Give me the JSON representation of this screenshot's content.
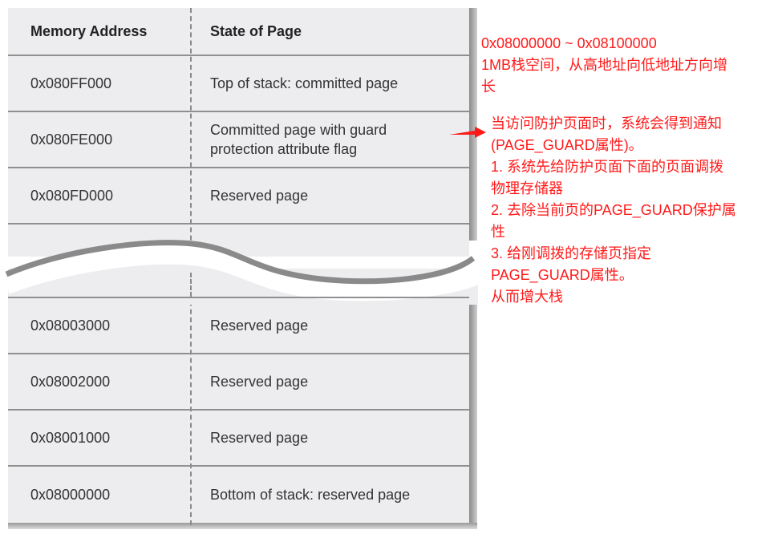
{
  "table": {
    "headers": [
      "Memory Address",
      "State of Page"
    ],
    "top_rows": [
      {
        "address": "0x080FF000",
        "state": "Top of stack: committed page"
      },
      {
        "address": "0x080FE000",
        "state": "Committed page with guard protection attribute flag"
      },
      {
        "address": "0x080FD000",
        "state": "Reserved page"
      }
    ],
    "bottom_rows": [
      {
        "address": "0x08003000",
        "state": "Reserved page"
      },
      {
        "address": "0x08002000",
        "state": "Reserved page"
      },
      {
        "address": "0x08001000",
        "state": "Reserved page"
      },
      {
        "address": "0x08000000",
        "state": "Bottom of stack: reserved page"
      }
    ]
  },
  "notes": {
    "range": [
      "0x08000000 ~ 0x08100000",
      "1MB栈空间，从高地址向低地址方向增",
      "长"
    ],
    "guard": [
      "当访问防护页面时，系统会得到通知",
      "(PAGE_GUARD属性)。",
      "1. 系统先给防护页面下面的页面调拨",
      "物理存储器",
      "2. 去除当前页的PAGE_GUARD保护属",
      "性",
      "3. 给刚调拨的存储页指定",
      "PAGE_GUARD属性。",
      "从而增大栈"
    ]
  },
  "colors": {
    "annotation": "#ff1a1a",
    "table_bg": "#ededf0",
    "lines": "#8f8f8f"
  }
}
